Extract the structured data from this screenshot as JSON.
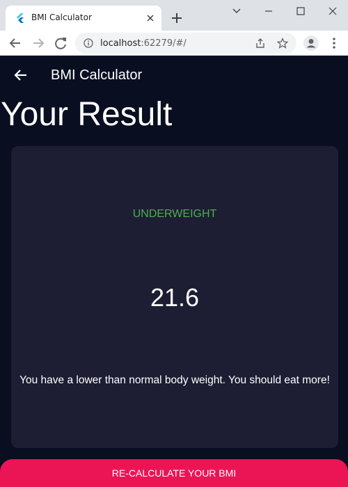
{
  "browser": {
    "tab_title": "BMI Calculator",
    "url_host": "localhost",
    "url_rest": ":62279/#/"
  },
  "app": {
    "appbar_title": "BMI Calculator",
    "page_title": "Your Result",
    "result": {
      "category": "UNDERWEIGHT",
      "value": "21.6",
      "advice": "You have a lower than normal body weight. You should eat more!"
    },
    "button_label": "RE-CALCULATE YOUR BMI"
  },
  "colors": {
    "background": "#0a0e21",
    "card": "#1d1e33",
    "category_text": "#4caf50",
    "button": "#eb1555"
  },
  "icons": {
    "favicon": "flutter-icon",
    "tab_close": "close-icon",
    "new_tab": "plus-icon",
    "back": "arrow-left-icon",
    "forward": "arrow-right-icon",
    "reload": "reload-icon",
    "site_info": "info-icon",
    "share": "share-icon",
    "bookmark": "star-icon",
    "profile": "person-icon",
    "menu": "more-vert-icon",
    "app_back": "arrow-left-icon"
  }
}
